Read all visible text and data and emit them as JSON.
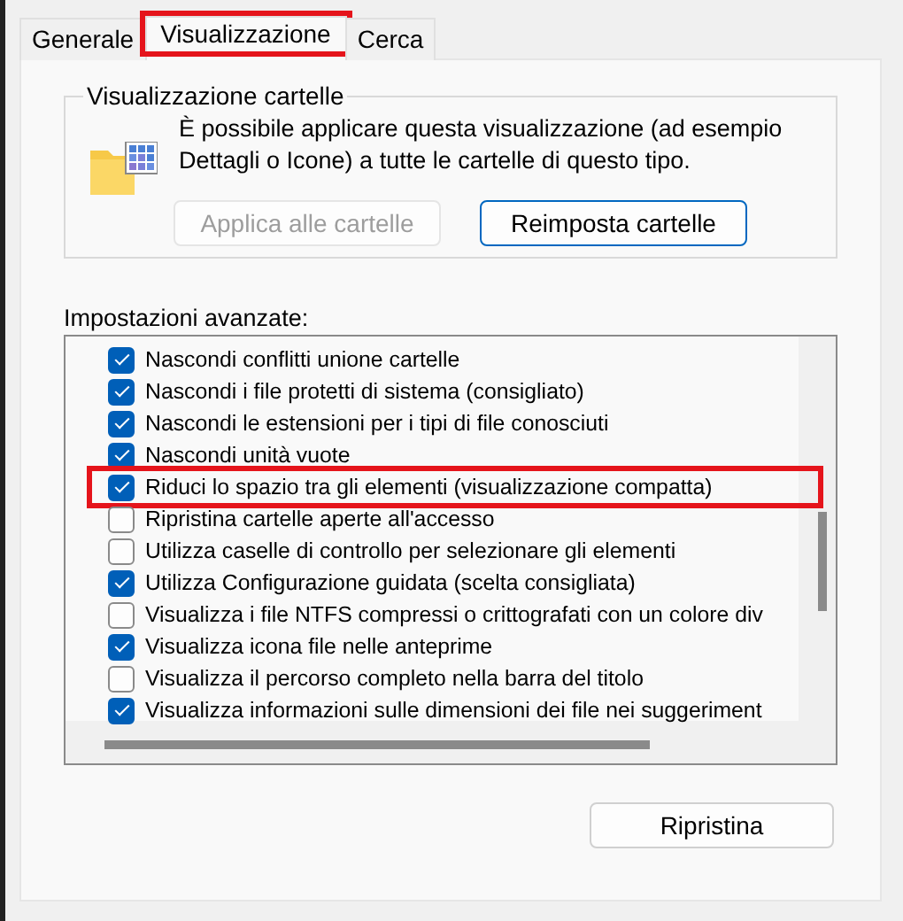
{
  "tabs": [
    {
      "label": "Generale",
      "selected": false,
      "highlighted": false
    },
    {
      "label": "Visualizzazione",
      "selected": true,
      "highlighted": true
    },
    {
      "label": "Cerca",
      "selected": false,
      "highlighted": false
    }
  ],
  "folder_view": {
    "title": "Visualizzazione cartelle",
    "description": "È possibile applicare questa visualizzazione (ad esempio Dettagli o Icone) a tutte le cartelle di questo tipo.",
    "buttons": [
      {
        "label": "Applica alle cartelle",
        "disabled": true
      },
      {
        "label": "Reimposta cartelle",
        "disabled": false
      }
    ]
  },
  "advanced": {
    "title": "Impostazioni avanzate:",
    "items": [
      {
        "label": "Nascondi conflitti unione cartelle",
        "checked": true,
        "highlighted": false
      },
      {
        "label": "Nascondi i file protetti di sistema (consigliato)",
        "checked": true,
        "highlighted": false
      },
      {
        "label": "Nascondi le estensioni per i tipi di file conosciuti",
        "checked": true,
        "highlighted": false
      },
      {
        "label": "Nascondi unità vuote",
        "checked": true,
        "highlighted": false
      },
      {
        "label": "Riduci lo spazio tra gli elementi (visualizzazione compatta)",
        "checked": true,
        "highlighted": true
      },
      {
        "label": "Ripristina cartelle aperte all'accesso",
        "checked": false,
        "highlighted": false
      },
      {
        "label": "Utilizza caselle di controllo per selezionare gli elementi",
        "checked": false,
        "highlighted": false
      },
      {
        "label": "Utilizza Configurazione guidata (scelta consigliata)",
        "checked": true,
        "highlighted": false
      },
      {
        "label": "Visualizza i file NTFS compressi o crittografati con un colore div",
        "checked": false,
        "highlighted": false
      },
      {
        "label": "Visualizza icona file nelle anteprime",
        "checked": true,
        "highlighted": false
      },
      {
        "label": "Visualizza il percorso completo nella barra del titolo",
        "checked": false,
        "highlighted": false
      },
      {
        "label": "Visualizza informazioni sulle dimensioni dei file nei suggeriment",
        "checked": true,
        "highlighted": false
      }
    ],
    "restore_button": "Ripristina"
  }
}
